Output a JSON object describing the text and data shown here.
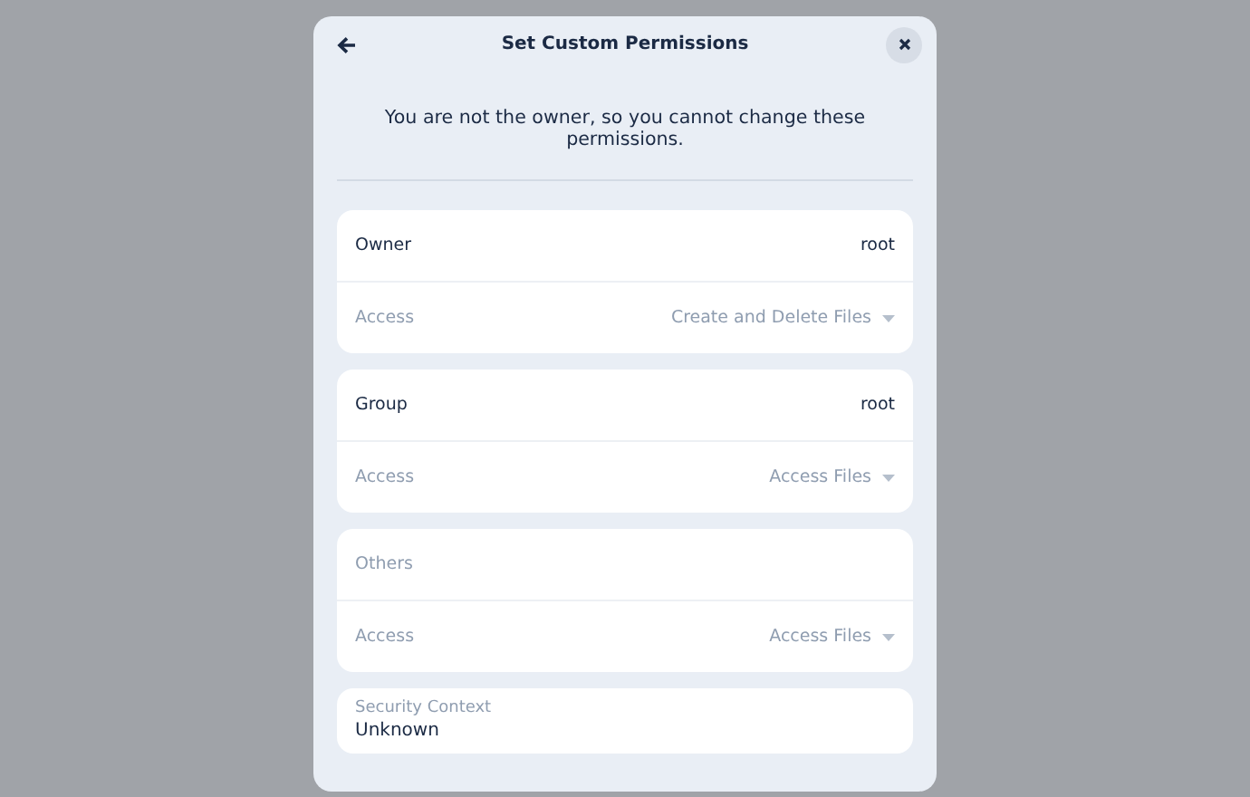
{
  "dialog": {
    "title": "Set Custom Permissions",
    "message": "You are not the owner, so you cannot change these permissions."
  },
  "sections": [
    {
      "label": "Owner",
      "value": "root",
      "disabled": false,
      "access": {
        "label": "Access",
        "value": "Create and Delete Files",
        "disabled": true
      }
    },
    {
      "label": "Group",
      "value": "root",
      "disabled": false,
      "access": {
        "label": "Access",
        "value": "Access Files",
        "disabled": true
      }
    },
    {
      "label": "Others",
      "disabled": true,
      "access": {
        "label": "Access",
        "value": "Access Files",
        "disabled": true
      }
    }
  ],
  "security_context": {
    "label": "Security Context",
    "value": "Unknown"
  }
}
